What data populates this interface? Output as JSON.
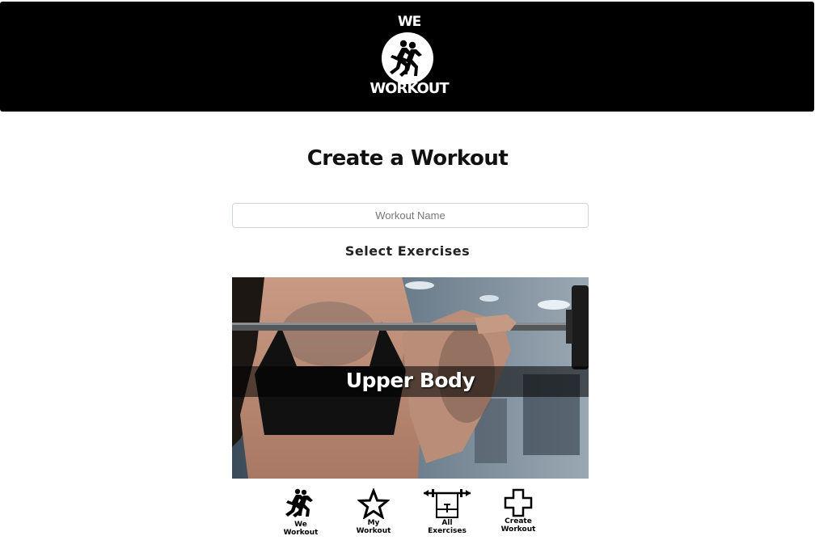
{
  "header": {
    "logo": {
      "top_text": "WE",
      "bottom_text": "WORKOUT",
      "icon": "runners-icon"
    }
  },
  "page": {
    "title": "Create a Workout",
    "workout_name": {
      "value": "",
      "placeholder": "Workout Name"
    },
    "select_label": "Select Exercises",
    "exercise_card": {
      "label": "Upper Body"
    }
  },
  "nav": {
    "items": [
      {
        "icon": "runners-icon",
        "line1": "We",
        "line2": "Workout"
      },
      {
        "icon": "star-icon",
        "line1": "My",
        "line2": "Workout"
      },
      {
        "icon": "barbell-icon",
        "line1": "All",
        "line2": "Exercises"
      },
      {
        "icon": "plus-icon",
        "line1": "Create",
        "line2": "Workout"
      }
    ]
  }
}
